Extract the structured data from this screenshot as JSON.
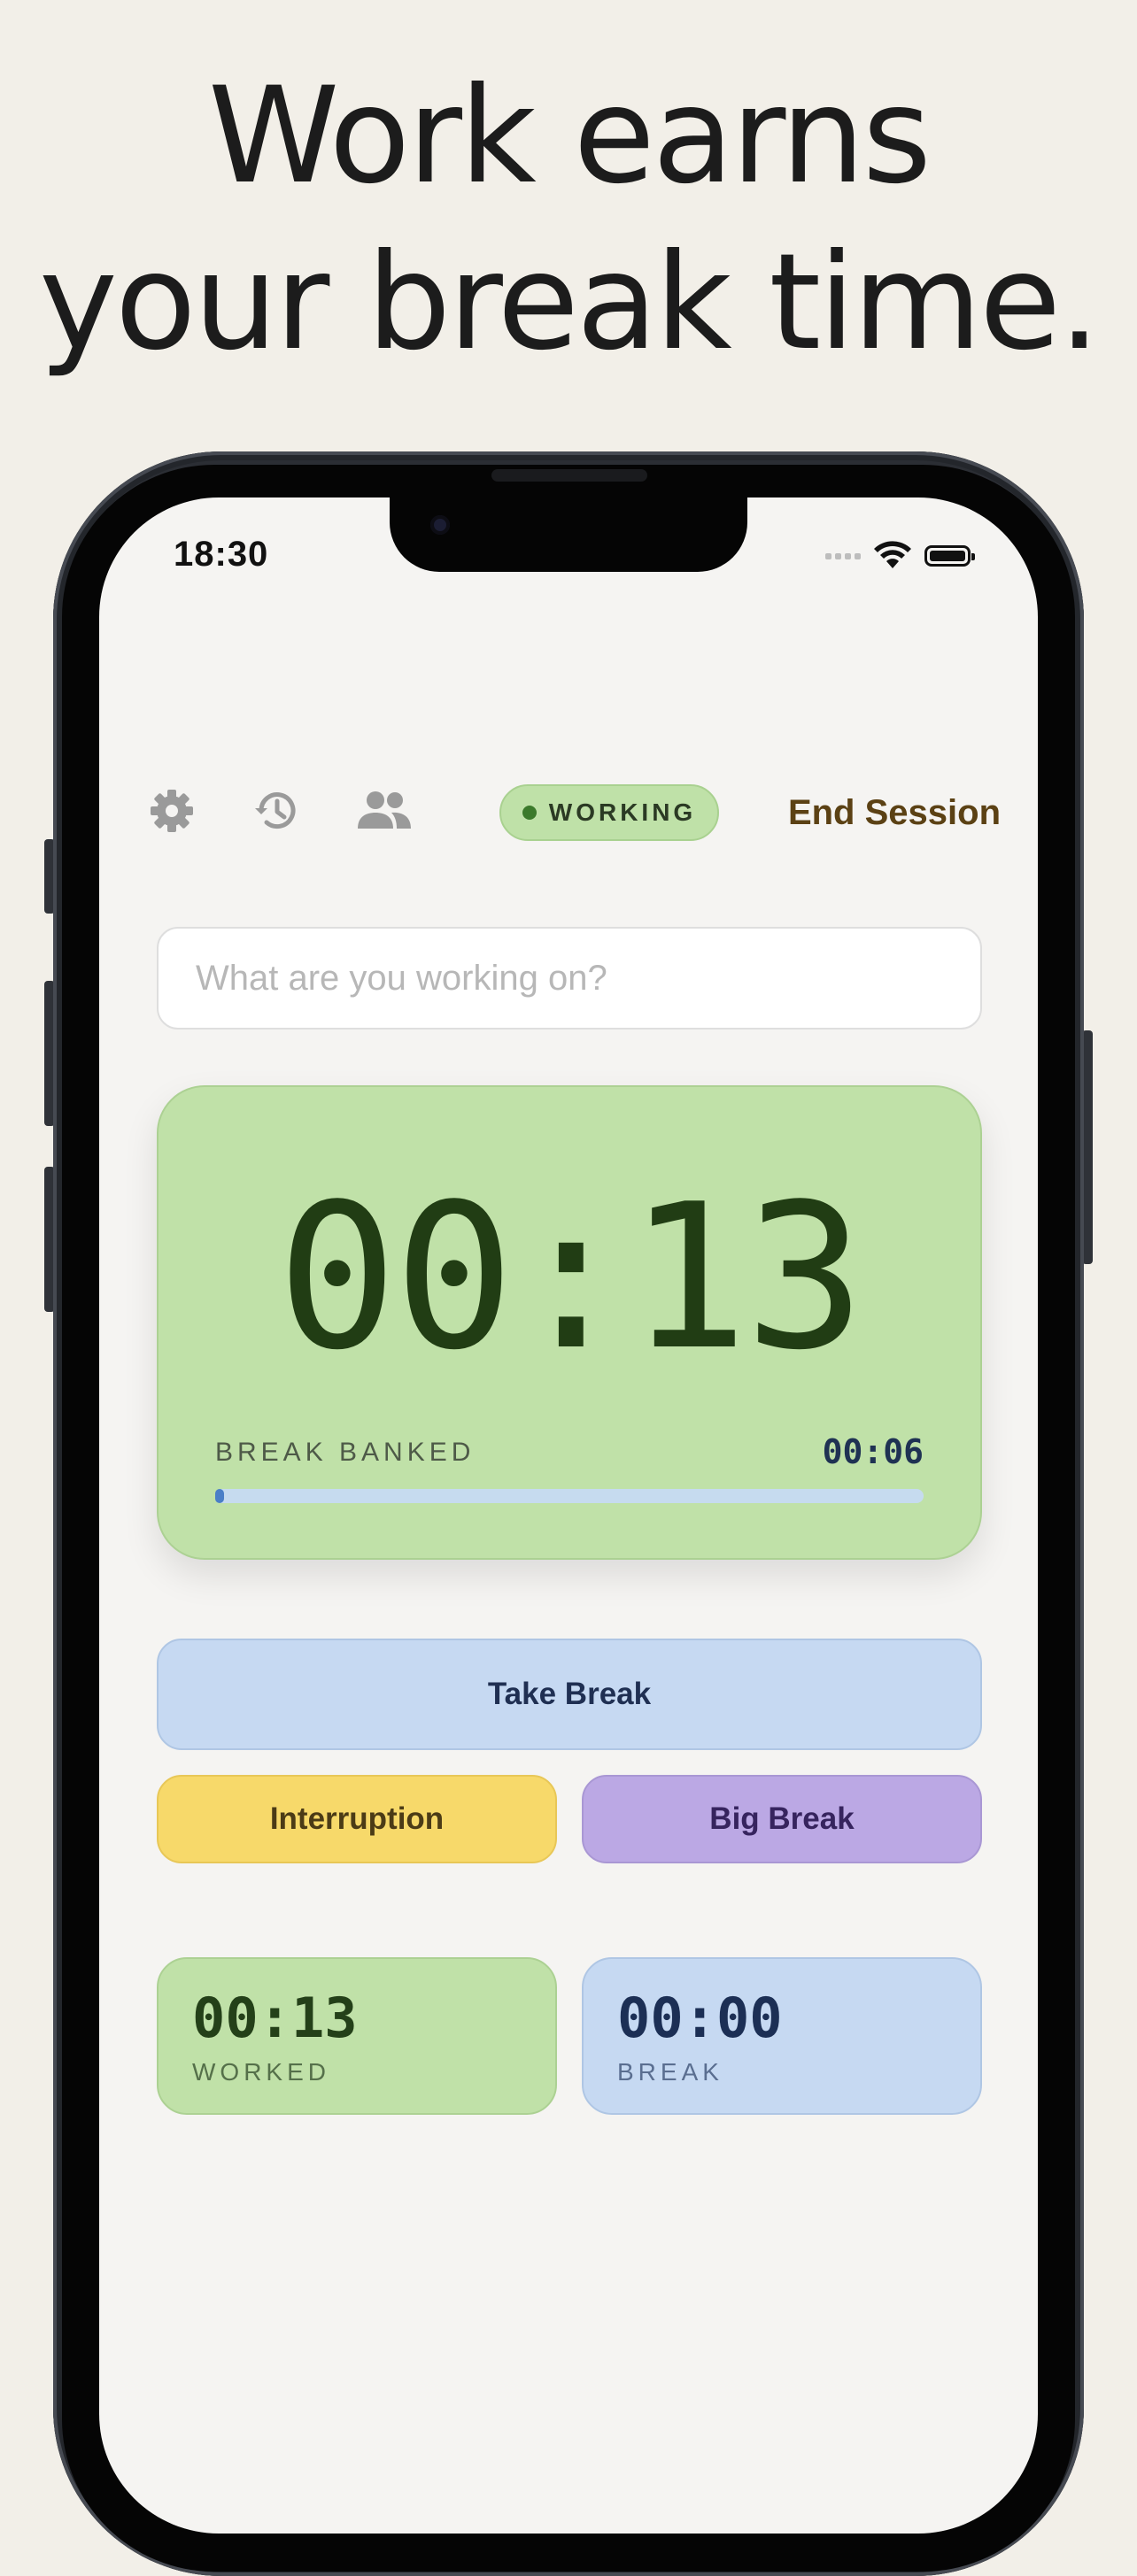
{
  "headline": {
    "line1": "Work earns",
    "line2": "your break time."
  },
  "status_bar": {
    "time": "18:30"
  },
  "toolbar": {
    "icons": [
      "gear-icon",
      "history-icon",
      "people-icon"
    ],
    "status_label": "WORKING",
    "end_session_label": "End Session"
  },
  "task": {
    "placeholder": "What are you working on?",
    "value": ""
  },
  "timer": {
    "main": "00:13",
    "banked_label": "BREAK BANKED",
    "banked_value": "00:06",
    "banked_progress": 0.01
  },
  "actions": {
    "take_break": "Take Break",
    "interruption": "Interruption",
    "big_break": "Big Break"
  },
  "stats": {
    "worked_value": "00:13",
    "worked_label": "WORKED",
    "break_value": "00:00",
    "break_label": "BREAK"
  },
  "colors": {
    "work_green": "#c0e1a8",
    "break_blue": "#c6d9f2",
    "interruption_yellow": "#f7d96a",
    "big_break_purple": "#bba8e4",
    "end_session_brown": "#5b4114"
  }
}
